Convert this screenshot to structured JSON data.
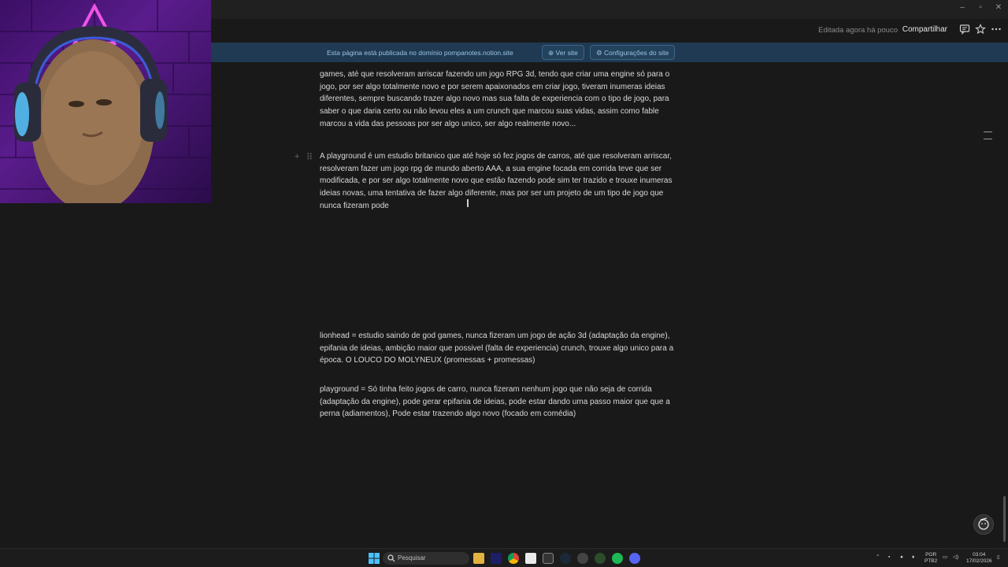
{
  "window": {
    "minimize": "–",
    "maximize": "▫",
    "close": "✕"
  },
  "topbar": {
    "edited": "Editada agora há pouco",
    "share": "Compartilhar"
  },
  "banner": {
    "text": "Esta página está publicada no domínio pompanotes.notion.site",
    "view_site": "Ver site",
    "site_settings": "Configurações do site"
  },
  "content": {
    "para1_lines": [
      "games, até que resolveram arriscar fazendo um jogo RPG 3d, tendo que criar uma engine só para o",
      "jogo, por ser algo totalmente novo e por serem apaixonados em criar jogo, tiveram inumeras ideias",
      "diferentes, sempre buscando trazer algo novo mas sua falta de experiencia com o tipo de jogo, para",
      "saber o que daria certo ou não levou eles a um crunch que marcou suas vidas, assim como fable",
      "marcou a vida das pessoas por ser algo unico, ser algo realmente novo..."
    ],
    "para2": "A playground é um estudio britanico que até hoje só fez jogos de carros, até que resolveram arriscar, resolveram fazer um jogo rpg de mundo aberto AAA, a sua engine focada em corrida teve que ser modificada, e por ser algo totalmente novo que estão fazendo pode sim ter trazido e trouxe inumeras ideias novas, uma tentativa de fazer algo diferente, mas por ser um projeto de um tipo de jogo que nunca fizeram pode",
    "para3": "lionhead = estudio saindo de god games, nunca fizeram um jogo de ação 3d (adaptação da engine), epifania de ideias, ambição maior que possivel (falta de experiencia) crunch, trouxe algo unico para a época. O LOUCO DO MOLYNEUX (promessas + promessas)",
    "para4": "playground = Só tinha feito jogos de carro, nunca fizeram nenhum jogo que não seja de corrida (adaptação da engine), pode gerar epifania de ideias, pode estar dando uma passo maior que que a perna (adiamentos), Pode estar trazendo algo novo (focado em comédia)"
  },
  "taskbar": {
    "search_placeholder": "Pesquisar",
    "lang_top": "POR",
    "lang_bottom": "PTB2",
    "time": "03:04",
    "date": "17/02/2026"
  },
  "colors": {
    "banner": "#1f3a52",
    "background": "#191919",
    "accent": "#9cc3e6"
  }
}
